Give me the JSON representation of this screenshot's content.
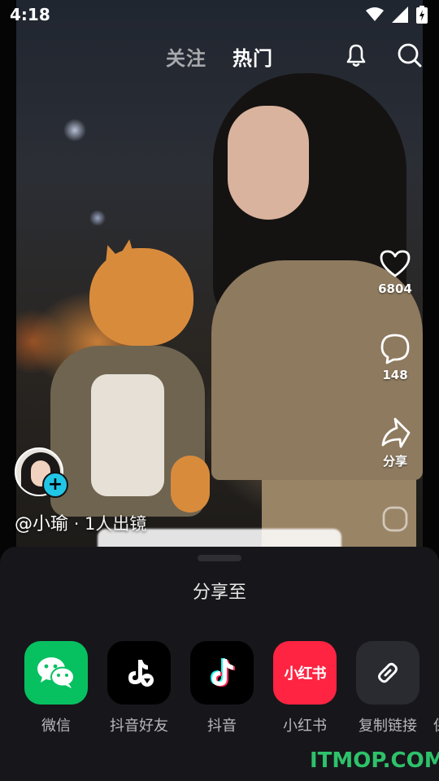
{
  "status_bar": {
    "time": "4:18"
  },
  "top_nav": {
    "tabs": [
      {
        "label": "关注"
      },
      {
        "label": "热门"
      }
    ]
  },
  "actions": {
    "like_count": "6804",
    "comment_count": "148",
    "share_label": "分享"
  },
  "author": {
    "name": "@小瑜",
    "tag": " · 1人出镜"
  },
  "share_sheet": {
    "title": "分享至",
    "targets": [
      {
        "label": "微信",
        "icon": "wechat-icon",
        "color": "#07c160"
      },
      {
        "label": "抖音好友",
        "icon": "douyin-friends-icon",
        "color": "#000000"
      },
      {
        "label": "抖音",
        "icon": "douyin-icon",
        "color": "#000000"
      },
      {
        "label": "小红书",
        "icon": "xiaohongshu-icon",
        "color": "#ff2442",
        "icon_text": "小红书"
      },
      {
        "label": "复制链接",
        "icon": "link-icon",
        "color": "#2a2b31"
      }
    ],
    "partial_label": "保"
  },
  "watermark": "ITMOP.COM"
}
